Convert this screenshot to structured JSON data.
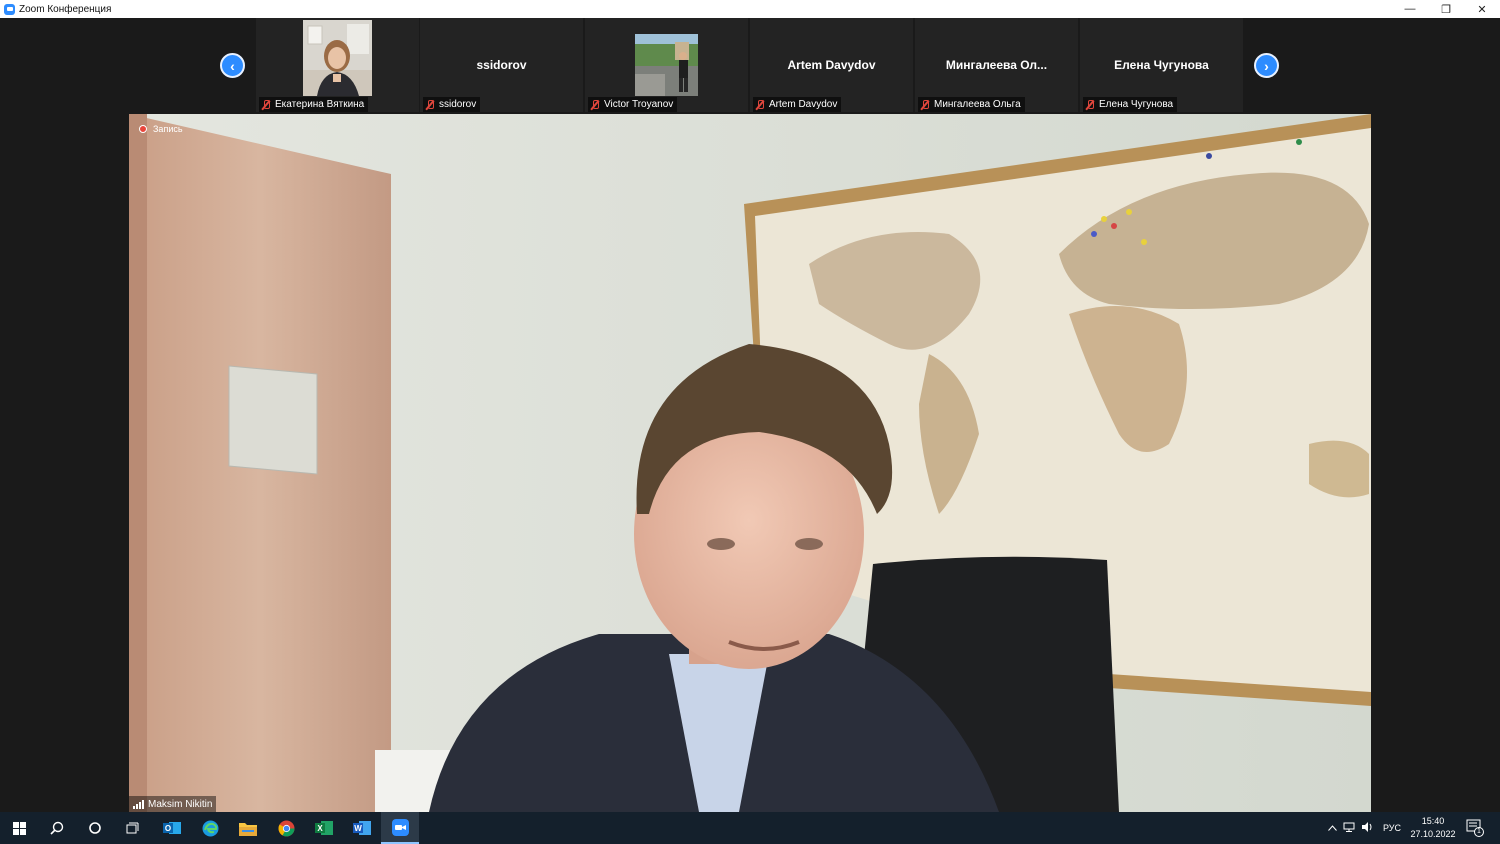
{
  "window": {
    "title": "Zoom Конференция",
    "minimize_glyph": "—",
    "restore_glyph": "❐",
    "close_glyph": "✕"
  },
  "gallery": {
    "prev_glyph": "‹",
    "next_glyph": "›",
    "participants": [
      {
        "name": "Екатерина Вяткина",
        "display": "",
        "has_video": true,
        "muted": true
      },
      {
        "name": "ssidorov",
        "display": "ssidorov",
        "has_video": false,
        "muted": true
      },
      {
        "name": "Victor Troyanov",
        "display": "",
        "has_video": true,
        "muted": true
      },
      {
        "name": "Artem Davydov",
        "display": "Artem Davydov",
        "has_video": false,
        "muted": true
      },
      {
        "name": "Мингалеева Ольга",
        "display": "Мингалеева  Ол...",
        "has_video": false,
        "muted": true
      },
      {
        "name": "Елена Чугунова",
        "display": "Елена Чугунова",
        "has_video": false,
        "muted": true
      }
    ]
  },
  "main_video": {
    "recording_label": "Запись",
    "speaker_name": "Maksim Nikitin"
  },
  "taskbar": {
    "language": "РУС",
    "time": "15:40",
    "date": "27.10.2022",
    "notification_count": "1",
    "apps": [
      "start-icon",
      "search-icon",
      "cortana-icon",
      "task-view-icon",
      "outlook-icon",
      "edge-icon",
      "file-explorer-icon",
      "chrome-icon",
      "excel-icon",
      "word-icon",
      "zoom-icon"
    ]
  },
  "colors": {
    "accent": "#2d8cff",
    "mute": "#e0463c",
    "taskbar": "#14202c"
  }
}
